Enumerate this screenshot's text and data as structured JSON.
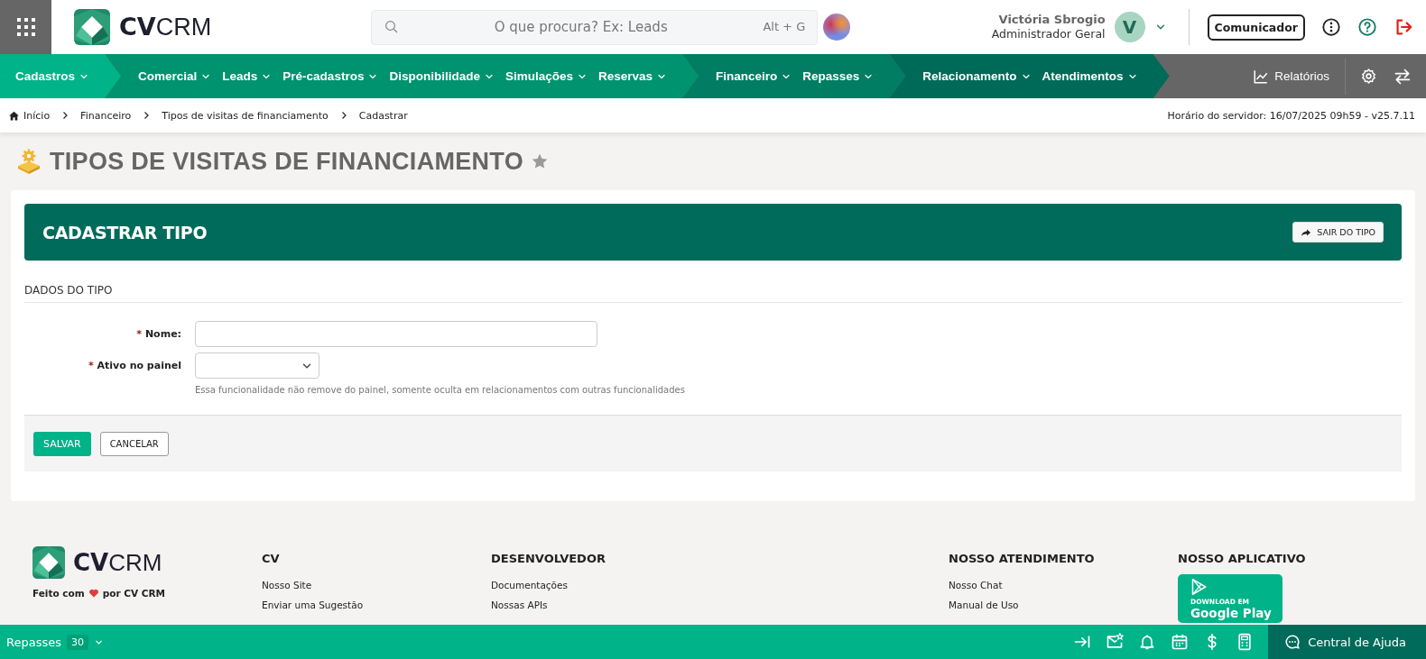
{
  "header": {
    "logo": {
      "bold": "CV",
      "light": "CRM"
    },
    "search": {
      "placeholder": "O que procura? Ex: Leads",
      "shortcut": "Alt + G"
    },
    "user": {
      "name": "Victória Sbrogio",
      "role": "Administrador Geral",
      "initial": "V"
    },
    "communicator": "Comunicador"
  },
  "nav": {
    "groups": [
      {
        "color": "#00b388",
        "items": [
          "Cadastros"
        ]
      },
      {
        "color": "#00936f",
        "items": [
          "Comercial",
          "Leads",
          "Pré-cadastros",
          "Disponibilidade",
          "Simulações",
          "Reservas"
        ]
      },
      {
        "color": "#007d62",
        "items": [
          "Financeiro",
          "Repasses"
        ]
      },
      {
        "color": "#006a58",
        "items": [
          "Relacionamento",
          "Atendimentos"
        ]
      }
    ],
    "reports": "Relatórios"
  },
  "breadcrumb": [
    "Início",
    "Financeiro",
    "Tipos de visitas de financiamento",
    "Cadastrar"
  ],
  "server_time": "Horário do servidor: 16/07/2025 09h59 - v25.7.11",
  "page_title": "TIPOS DE VISITAS DE FINANCIAMENTO",
  "form": {
    "title": "CADASTRAR TIPO",
    "exit_button": "SAIR DO TIPO",
    "section": "DADOS DO TIPO",
    "fields": [
      {
        "kind": "text",
        "marker": "*",
        "label": "Nome:"
      },
      {
        "kind": "select",
        "marker": "*",
        "label": "Ativo no painel",
        "help": "Essa funcionalidade não remove do painel, somente oculta em relacionamentos com outras funcionalidades"
      }
    ],
    "buttons": [
      {
        "kind": "primary",
        "label": "SALVAR"
      },
      {
        "kind": "secondary",
        "label": "CANCELAR"
      }
    ]
  },
  "footer": {
    "logo": {
      "bold": "CV",
      "light": "CRM"
    },
    "made_with": "Feito com",
    "made_by": "por CV CRM",
    "columns": [
      {
        "title": "CV",
        "links": [
          "Nosso Site",
          "Enviar uma Sugestão"
        ]
      },
      {
        "title": "DESENVOLVEDOR",
        "links": [
          "Documentações",
          "Nossas APIs"
        ]
      },
      {
        "title": "NOSSO ATENDIMENTO",
        "links": [
          "Nosso Chat",
          "Manual de Uso"
        ]
      }
    ],
    "app": {
      "title": "NOSSO APLICATIVO",
      "store_small": "DOWNLOAD EM",
      "store_big": "Google Play"
    }
  },
  "bottom_bar": {
    "label": "Repasses",
    "count": "30",
    "help": "Central de Ajuda"
  }
}
